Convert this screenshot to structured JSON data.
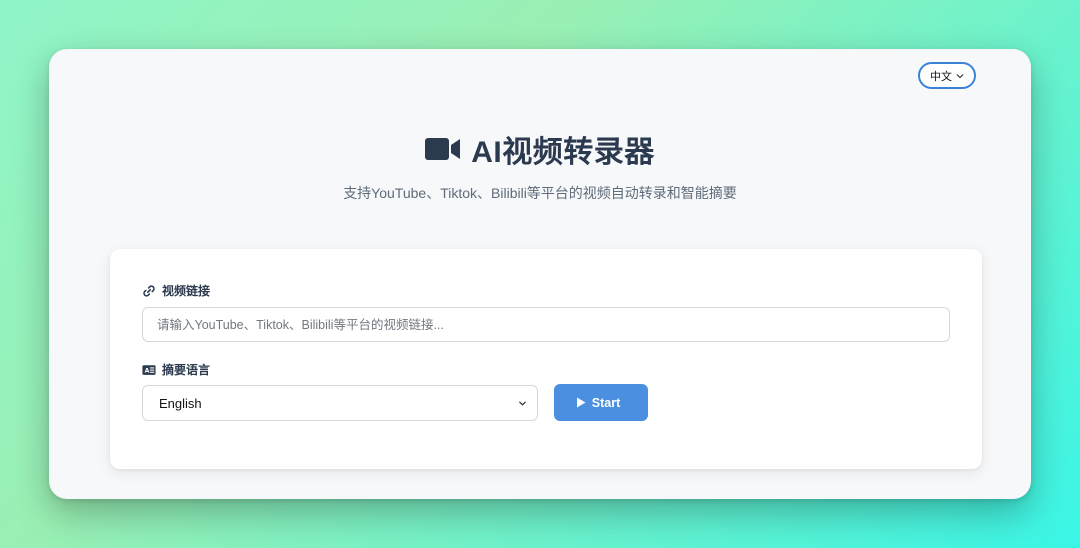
{
  "header": {
    "language_button": "中文",
    "title": "AI视频转录器",
    "subtitle": "支持YouTube、Tiktok、Bilibili等平台的视频自动转录和智能摘要"
  },
  "form": {
    "video_link_label": "视频链接",
    "video_link_placeholder": "请输入YouTube、Tiktok、Bilibili等平台的视频链接...",
    "summary_language_label": "摘要语言",
    "summary_language_value": "English",
    "start_button": "Start"
  },
  "colors": {
    "accent": "#3b82d6",
    "start_button": "#4a8fe0",
    "title_text": "#2c3a4f"
  },
  "icons": {
    "title": "video-camera-icon",
    "link": "link-icon",
    "language": "translate-icon",
    "start": "play-icon",
    "dropdown": "chevron-down-icon"
  }
}
